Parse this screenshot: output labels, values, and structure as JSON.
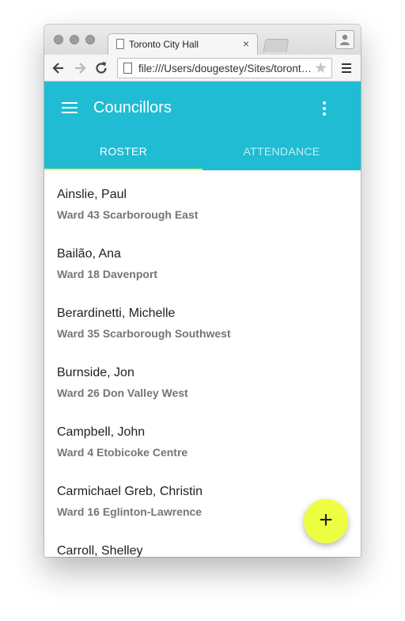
{
  "browser": {
    "tab_title": "Toronto City Hall",
    "tab_close": "×",
    "url": "file:///Users/dougestey/Sites/toronto-city-hall/index.html",
    "star": "★"
  },
  "app": {
    "title": "Councillors",
    "tabs": [
      "ROSTER",
      "ATTENDANCE"
    ],
    "active_tab": "ROSTER",
    "fab_label": "+",
    "colors": {
      "primary": "#1fbcd3",
      "accent": "#eeff41"
    }
  },
  "councillors": [
    {
      "name": "Ainslie, Paul",
      "ward": "Ward 43 Scarborough East"
    },
    {
      "name": "Bailão, Ana",
      "ward": "Ward 18 Davenport"
    },
    {
      "name": "Berardinetti, Michelle",
      "ward": "Ward 35 Scarborough Southwest"
    },
    {
      "name": "Burnside, Jon",
      "ward": "Ward 26 Don Valley West"
    },
    {
      "name": "Campbell, John",
      "ward": "Ward 4 Etobicoke Centre"
    },
    {
      "name": "Carmichael Greb, Christin",
      "ward": "Ward 16 Eglinton-Lawrence"
    },
    {
      "name": "Carroll, Shelley",
      "ward": ""
    }
  ]
}
